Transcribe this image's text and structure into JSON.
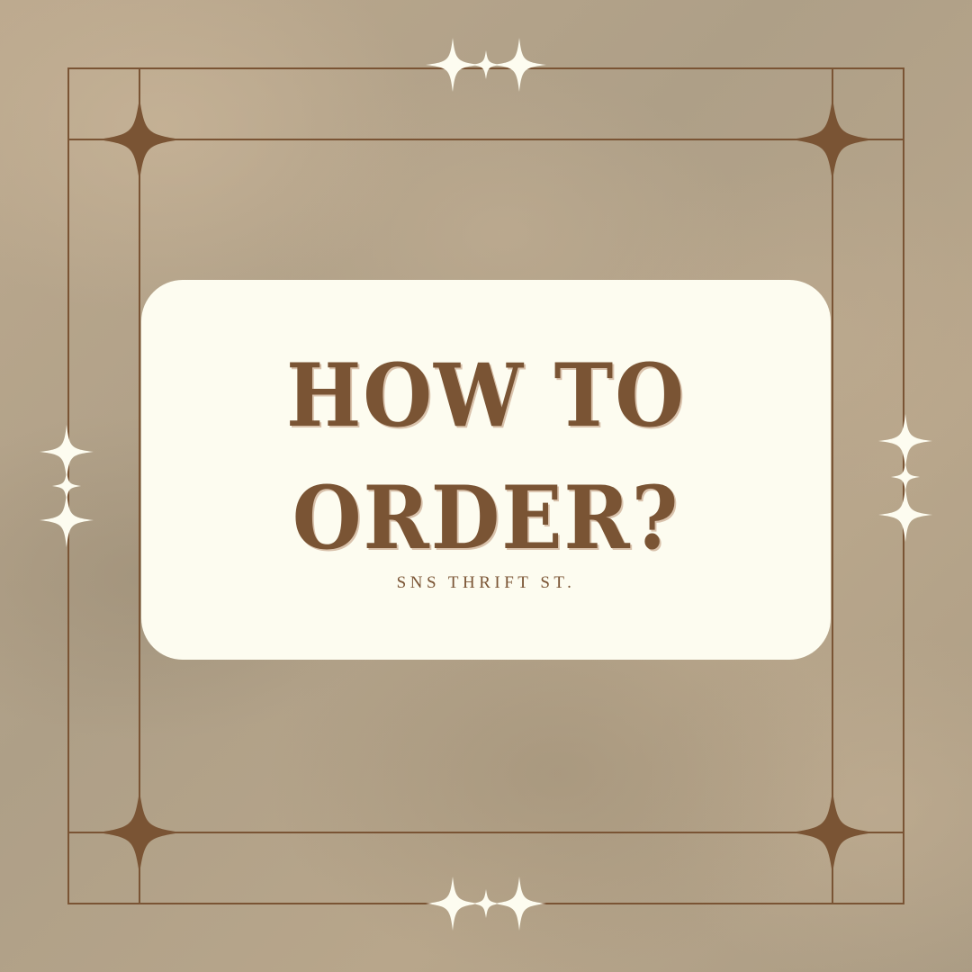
{
  "title": {
    "line1": "HOW TO",
    "line2": "ORDER?"
  },
  "subtitle": "SNS THRIFT ST.",
  "colors": {
    "background": "#b4a58d",
    "card": "#fdfcf0",
    "frame": "#7a5434",
    "text": "#7a5434",
    "sparkle": "#fdfcf0"
  },
  "icons": {
    "frame_corner": "four-point-star-icon",
    "sparkles": "sparkle-icon"
  }
}
